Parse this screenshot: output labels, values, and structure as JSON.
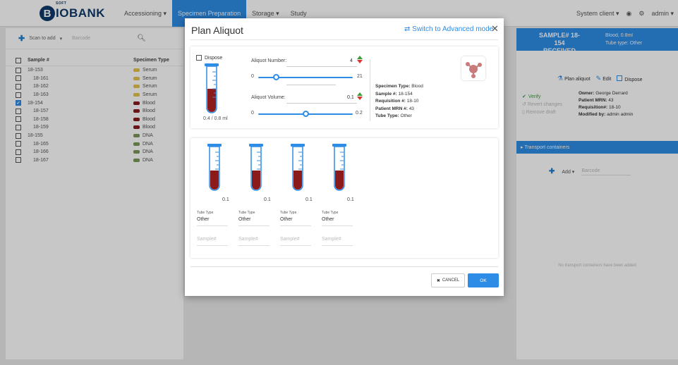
{
  "app": {
    "logo_text": "IOBANK",
    "logo_letter": "B",
    "logo_soft": "SOFT",
    "nav": [
      "Accessioning ▾",
      "Specimen Preparation",
      "Storage ▾",
      "Study"
    ],
    "client": "System client ▾",
    "admin": "admin ▾"
  },
  "left": {
    "scan_label": "Scan to add",
    "barcode_placeholder": "Barcode",
    "col_sample": "Sample #",
    "col_type": "Specimen Type",
    "rows": [
      {
        "sample": "18-153",
        "type": "Serum",
        "checked": false,
        "indent": false
      },
      {
        "sample": "18-161",
        "type": "Serum",
        "checked": false,
        "indent": true
      },
      {
        "sample": "18-162",
        "type": "Serum",
        "checked": false,
        "indent": true
      },
      {
        "sample": "18-163",
        "type": "Serum",
        "checked": false,
        "indent": true
      },
      {
        "sample": "18-154",
        "type": "Blood",
        "checked": true,
        "indent": false
      },
      {
        "sample": "18-157",
        "type": "Blood",
        "checked": false,
        "indent": true
      },
      {
        "sample": "18-158",
        "type": "Blood",
        "checked": false,
        "indent": true
      },
      {
        "sample": "18-159",
        "type": "Blood",
        "checked": false,
        "indent": true
      },
      {
        "sample": "18-155",
        "type": "DNA",
        "checked": false,
        "indent": false
      },
      {
        "sample": "18-165",
        "type": "DNA",
        "checked": false,
        "indent": true
      },
      {
        "sample": "18-166",
        "type": "DNA",
        "checked": false,
        "indent": true
      },
      {
        "sample": "18-167",
        "type": "DNA",
        "checked": false,
        "indent": true
      }
    ]
  },
  "right": {
    "sample_title": "SAMPLE# 18-154",
    "sample_status": "RECEIVED",
    "sample_vol": "Blood, 0.8ml",
    "sample_tube": "Tube type: Other",
    "plan_aliquot": "Plan aliquot",
    "edit": "Edit",
    "dispose": "Dispose",
    "verify": "Verify",
    "revert": "Revert changes",
    "remove_draft": "Remove draft",
    "owner_label": "Owner:",
    "owner": "George Derrard",
    "mrn_label": "Patient MRN:",
    "mrn": "43",
    "req_label": "Requisition#:",
    "req": "18-10",
    "mod_label": "Modified by:",
    "mod": "admin admin",
    "transport": "▸ Transport containers",
    "add": "Add ▾",
    "barcode": "Barcode",
    "no_transport": "No transport containers have been added"
  },
  "modal": {
    "title": "Plan Aliquot",
    "advanced": "⇄ Switch to Advanced mode",
    "close": "✕",
    "dispose_label": "Dispose",
    "volume_text": "0.4 / 0.8 ml",
    "aliquot_number_label": "Aliquot Number:",
    "aliquot_number": "4",
    "aliquot_min": "0",
    "aliquot_max": "21",
    "aliquot_fraction": 0.19,
    "aliquot_volume_label": "Aliquot Volume:",
    "aliquot_volume": "0.1",
    "volume_min": "0",
    "volume_max": "0.2",
    "volume_fraction": 0.5,
    "info": {
      "type_label": "Specimen Type:",
      "type": "Blood",
      "sample_label": "Sample #:",
      "sample": "18-154",
      "req_label": "Requisition #:",
      "req": "18-10",
      "mrn_label": "Patient MRN #:",
      "mrn": "43",
      "tube_label": "Tube Type:",
      "tube": "Other"
    },
    "aliquots": [
      {
        "amount": "0.1",
        "tube_type_label": "Tube Type",
        "tube_type": "Other",
        "sample_placeholder": "Sample#"
      },
      {
        "amount": "0.1",
        "tube_type_label": "Tube Type",
        "tube_type": "Other",
        "sample_placeholder": "Sample#"
      },
      {
        "amount": "0.1",
        "tube_type_label": "Tube Type",
        "tube_type": "Other",
        "sample_placeholder": "Sample#"
      },
      {
        "amount": "0.1",
        "tube_type_label": "Tube Type",
        "tube_type": "Other",
        "sample_placeholder": "Sample#"
      }
    ],
    "cancel": "CANCEL",
    "ok": "OK"
  },
  "colors": {
    "accent": "#2d8ce6",
    "blood": "#8b1a1a",
    "serum": "#e8c04a",
    "dna": "#7a9a55"
  }
}
